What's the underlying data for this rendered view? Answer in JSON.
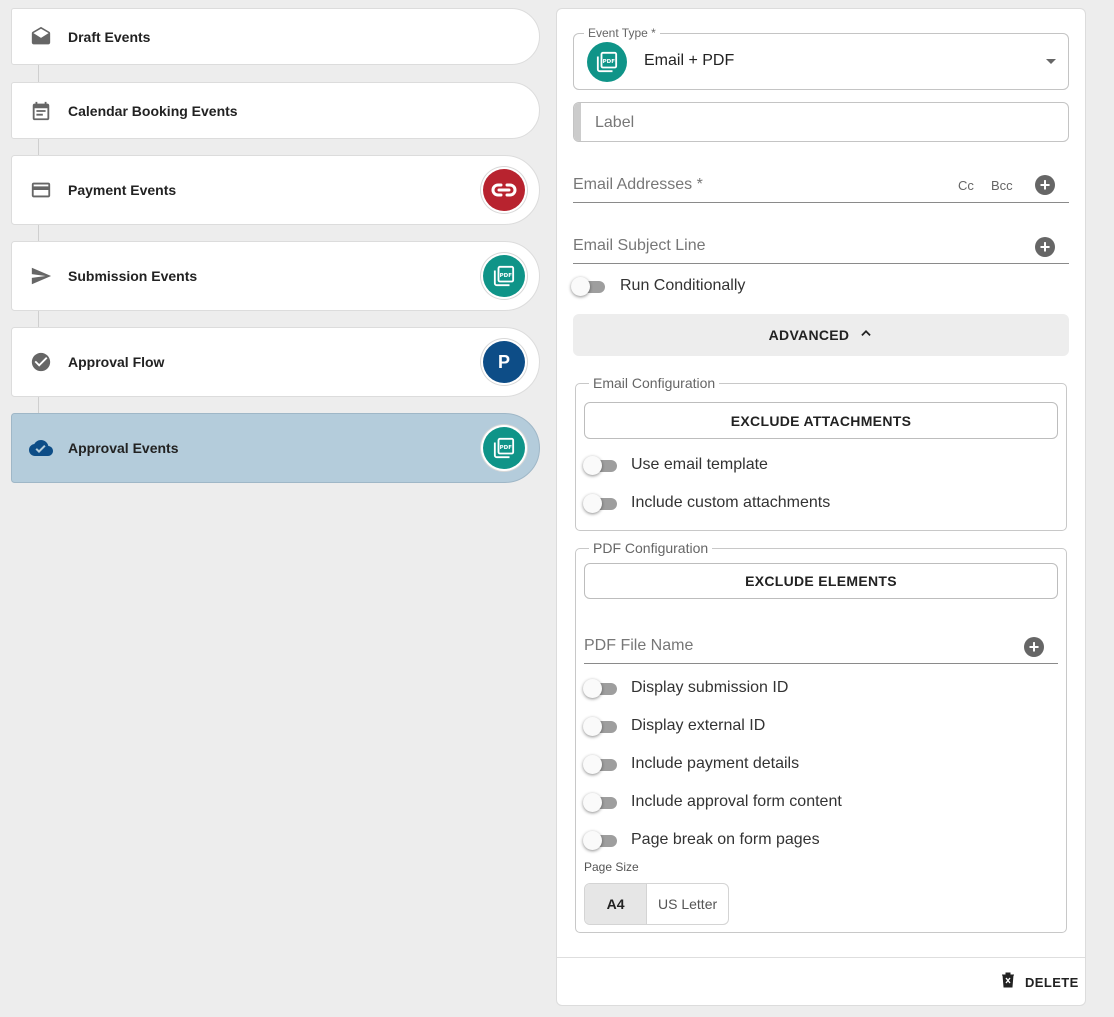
{
  "sidebar": {
    "events": [
      {
        "label": "Draft Events",
        "icon": "envelope-open-icon"
      },
      {
        "label": "Calendar Booking Events",
        "icon": "calendar-icon"
      },
      {
        "label": "Payment Events",
        "icon": "credit-card-icon",
        "badge": "cp-logo-icon",
        "badge_color": "#b8232f"
      },
      {
        "label": "Submission Events",
        "icon": "send-icon",
        "badge": "pdf-icon",
        "badge_color": "#0f9488"
      },
      {
        "label": "Approval Flow",
        "icon": "check-circle-icon",
        "badge": "P",
        "badge_color": "#0d4d87"
      },
      {
        "label": "Approval Events",
        "icon": "cloud-check-icon",
        "badge": "pdf-icon",
        "badge_color": "#0f9488",
        "active": true
      }
    ]
  },
  "panel": {
    "event_type": {
      "legend": "Event Type *",
      "value": "Email + PDF"
    },
    "label_field": {
      "placeholder": "Label"
    },
    "email_addresses": {
      "placeholder": "Email Addresses *",
      "cc": "Cc",
      "bcc": "Bcc"
    },
    "email_subject": {
      "placeholder": "Email Subject Line"
    },
    "run_conditionally": "Run Conditionally",
    "advanced_label": "ADVANCED",
    "email_config": {
      "legend": "Email Configuration",
      "exclude_attachments": "EXCLUDE ATTACHMENTS",
      "toggles": [
        "Use email template",
        "Include custom attachments"
      ]
    },
    "pdf_config": {
      "legend": "PDF Configuration",
      "exclude_elements": "EXCLUDE ELEMENTS",
      "file_name_placeholder": "PDF File Name",
      "toggles": [
        "Display submission ID",
        "Display external ID",
        "Include payment details",
        "Include approval form content",
        "Page break on form pages"
      ],
      "page_size_label": "Page Size",
      "page_sizes": [
        "A4",
        "US Letter"
      ],
      "selected_page_size": "A4"
    },
    "delete_label": "DELETE"
  },
  "colors": {
    "active_event_bg": "#b4ccdb",
    "teal_badge": "#0f9488",
    "red_badge": "#b8232f",
    "blue_badge": "#0d4d87"
  }
}
